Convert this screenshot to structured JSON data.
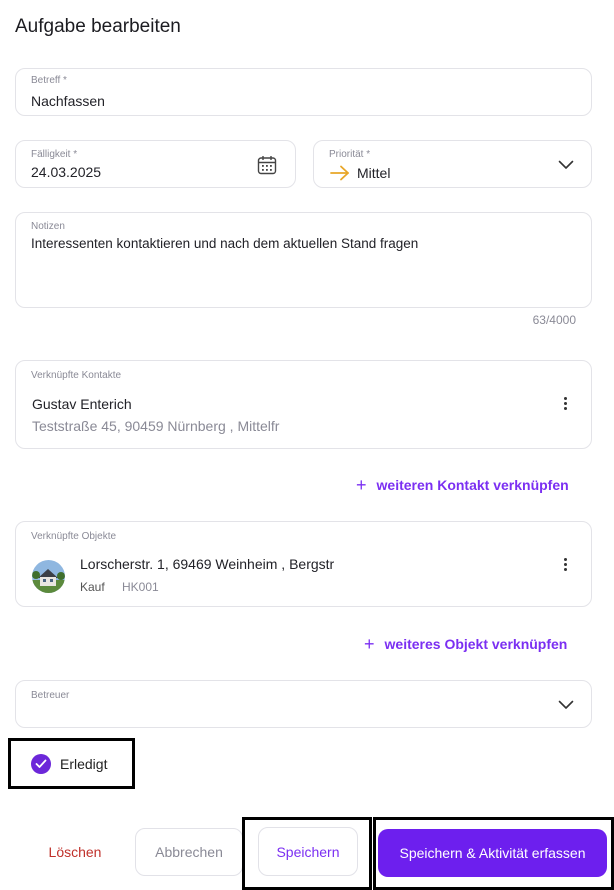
{
  "header": {
    "title": "Aufgabe bearbeiten"
  },
  "subject": {
    "label": "Betreff *",
    "value": "Nachfassen"
  },
  "due": {
    "label": "Fälligkeit *",
    "value": "24.03.2025",
    "icon": "calendar-icon"
  },
  "priority": {
    "label": "Priorität *",
    "value": "Mittel",
    "icon": "arrow-right-icon",
    "icon_color": "#e8a628"
  },
  "notes": {
    "label": "Notizen",
    "value": "Interessenten kontaktieren und nach dem aktuellen Stand fragen",
    "counter": "63/4000"
  },
  "contacts": {
    "label": "Verknüpfte Kontakte",
    "items": [
      {
        "name": "Gustav Enterich",
        "address": "Teststraße 45, 90459 Nürnberg , Mittelfr"
      }
    ],
    "add_label": "weiteren Kontakt verknüpfen"
  },
  "objects": {
    "label": "Verknüpfte Objekte",
    "items": [
      {
        "address": "Lorscherstr. 1, 69469 Weinheim , Bergstr",
        "type": "Kauf",
        "ref": "HK001"
      }
    ],
    "add_label": "weiteres Objekt verknüpfen"
  },
  "assignee": {
    "label": "Betreuer",
    "value": ""
  },
  "done": {
    "label": "Erledigt",
    "checked": true
  },
  "actions": {
    "delete": "Löschen",
    "cancel": "Abbrechen",
    "save": "Speichern",
    "save_activity": "Speichern & Aktivität erfassen"
  },
  "colors": {
    "accent": "#7b2ff2",
    "danger": "#c0312b",
    "primary_button": "#6d1fee"
  }
}
